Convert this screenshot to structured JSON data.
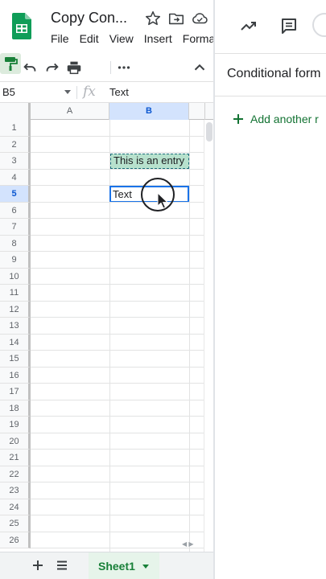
{
  "header": {
    "doc_title": "Copy Con...",
    "menus": [
      "File",
      "Edit",
      "View",
      "Insert",
      "Forma"
    ]
  },
  "formula_bar": {
    "name_box": "B5",
    "fx_label": "fx",
    "value": "Text"
  },
  "grid": {
    "columns": [
      "A",
      "B"
    ],
    "rows": [
      "1",
      "2",
      "3",
      "4",
      "5",
      "6",
      "7",
      "8",
      "9",
      "10",
      "11",
      "12",
      "13",
      "14",
      "15",
      "16",
      "17",
      "18",
      "19",
      "20",
      "21",
      "22",
      "23",
      "24",
      "25",
      "26"
    ],
    "active_row": "5",
    "cells": {
      "b3": "This is an entry",
      "b5": "Text"
    }
  },
  "sheet_tabs": {
    "active": "Sheet1"
  },
  "side_panel": {
    "title": "Conditional form",
    "add_rule_label": "Add another r"
  },
  "colors": {
    "brand_green": "#188038",
    "selection_blue": "#1a73e8",
    "highlight_fill": "#b7e1cd"
  }
}
